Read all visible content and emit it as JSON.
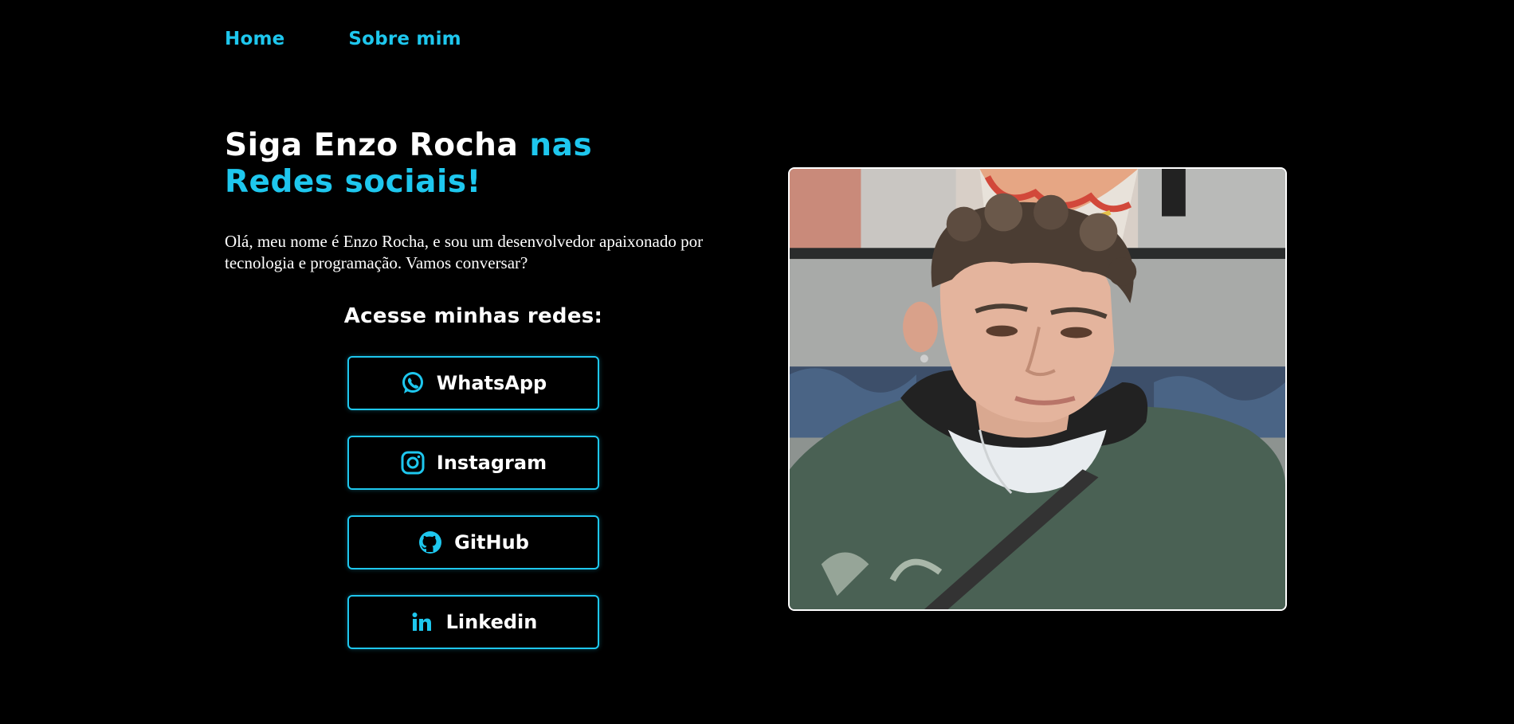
{
  "nav": {
    "items": [
      {
        "label": "Home"
      },
      {
        "label": "Sobre mim"
      }
    ]
  },
  "hero": {
    "title_white": "Siga Enzo Rocha ",
    "title_cyan": "nas Redes sociais!",
    "intro": "Olá, meu nome é Enzo Rocha, e sou um desenvolvedor apaixonado por tecnologia e programação. Vamos conversar?"
  },
  "social": {
    "title": "Acesse minhas redes:",
    "links": [
      {
        "label": "WhatsApp",
        "icon": "whatsapp-icon"
      },
      {
        "label": "Instagram",
        "icon": "instagram-icon"
      },
      {
        "label": "GitHub",
        "icon": "github-icon"
      },
      {
        "label": "Linkedin",
        "icon": "linkedin-icon"
      }
    ]
  },
  "colors": {
    "background": "#000000",
    "accent": "#1ec7ee",
    "text": "#ffffff"
  }
}
